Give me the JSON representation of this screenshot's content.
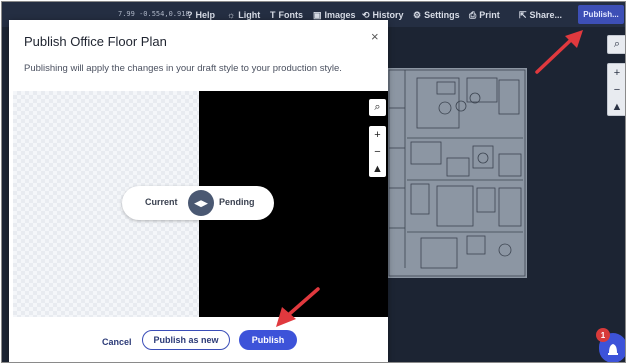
{
  "toolbar": {
    "coords": "7.99 -0.554,0.918",
    "items": [
      {
        "label": "Help",
        "icon": "help-icon",
        "glyph": "?"
      },
      {
        "label": "Light",
        "icon": "sun-icon",
        "glyph": "☼"
      },
      {
        "label": "Fonts",
        "icon": "font-icon",
        "glyph": "T"
      },
      {
        "label": "Images",
        "icon": "image-icon",
        "glyph": "▣"
      },
      {
        "label": "History",
        "icon": "history-icon",
        "glyph": "⟲"
      },
      {
        "label": "Settings",
        "icon": "gear-icon",
        "glyph": "⚙"
      },
      {
        "label": "Print",
        "icon": "print-icon",
        "glyph": "⎙"
      },
      {
        "label": "Share...",
        "icon": "share-icon",
        "glyph": "⇱"
      }
    ],
    "publish_label": "Publish..."
  },
  "map_controls": {
    "search": "⌕",
    "zoom_in": "+",
    "zoom_out": "−",
    "compass": "▲"
  },
  "dialog": {
    "title": "Publish Office Floor Plan",
    "close": "×",
    "subtitle": "Publishing will apply the changes in your draft style to your production style.",
    "compare": {
      "current_label": "Current",
      "pending_label": "Pending",
      "knob": "◀▶"
    },
    "cancel_label": "Cancel",
    "publish_new_label": "Publish as new",
    "publish_label": "Publish"
  },
  "notification": {
    "count": "1"
  },
  "colors": {
    "accent": "#3d53d9",
    "toolbar": "#242e42",
    "arrow": "#e0393e"
  }
}
